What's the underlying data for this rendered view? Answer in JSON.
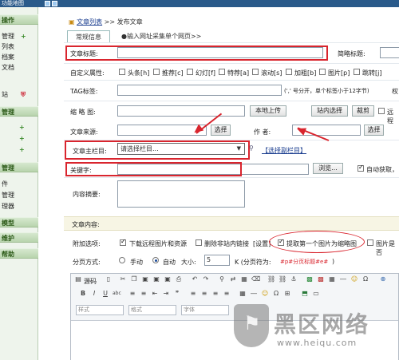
{
  "window": {
    "title": "功能地图"
  },
  "sidebar": {
    "groups": [
      {
        "label": "操作",
        "items": [
          "管理",
          "列表",
          "档案",
          "文档"
        ]
      },
      {
        "label": "",
        "items": [
          "站"
        ]
      },
      {
        "label": "管理",
        "items": [
          "",
          "",
          ""
        ]
      },
      {
        "label": "管理",
        "items": [
          "件",
          "管理",
          "理器"
        ]
      },
      {
        "label": "模型",
        "items": []
      },
      {
        "label": "维护",
        "items": []
      },
      {
        "label": "帮助",
        "items": []
      }
    ]
  },
  "breadcrumb": {
    "link": "文章列表",
    "sep": ">>",
    "current": "发布文章"
  },
  "tabs": [
    "常规信息",
    "●输入网址采集单个网页>>"
  ],
  "form": {
    "title_label": "文章标题:",
    "short_title_label": "简略标题:",
    "custom_attr_label": "自定义属性:",
    "attrs": [
      "头条[h]",
      "推荐[c]",
      "幻灯[f]",
      "特荐[a]",
      "滚动[s]",
      "加粗[b]",
      "图片[p]",
      "跳转[j]"
    ],
    "tag_label": "TAG标签:",
    "tag_hint": "(',' 号分开，单个标签小于12字节)",
    "tag_hint2": "权",
    "thumb_label": "缩 略 图:",
    "upload_btn": "本地上传",
    "site_select_btn": "站内选择",
    "crop_btn": "裁剪",
    "remote_label": "远程",
    "source_label": "文章来源:",
    "source_select": "选择",
    "author_label": "作  者:",
    "author_select": "选择",
    "column_label": "文章主栏目:",
    "column_select": "请选择栏目...",
    "sub_column": "【选择副栏目】",
    "keywords_label": "关键字:",
    "browse_btn": "浏览...",
    "auto_fetch": "自动获取，",
    "summary_label": "内容摘要:"
  },
  "content": {
    "section_title": "文章内容:",
    "extra_label": "附加选项:",
    "opt_download": "下载远程图片和资源",
    "opt_delete_links": "删除非站内链接",
    "opt_settings": "[设置]",
    "opt_extract_thumb": "提取第一个图片为缩略图",
    "opt_image_is": "图片是否",
    "paging_label": "分页方式:",
    "paging_manual": "手动",
    "paging_auto": "自动",
    "size_label": "大小:",
    "size_value": "5",
    "size_unit": "K (分页符为:",
    "page_mark": "#p#分页标题#e#",
    "paren": ")"
  },
  "editor": {
    "source": "源码",
    "style_ph": "样式",
    "format_ph": "格式",
    "font_ph": "字体"
  },
  "watermark": {
    "text": "黑区网络",
    "url": "www.heiqu.com"
  },
  "colors": {
    "annotation": "#d9252e",
    "sidebar_bg": "#eef4ec",
    "link": "#1a3d8f"
  }
}
